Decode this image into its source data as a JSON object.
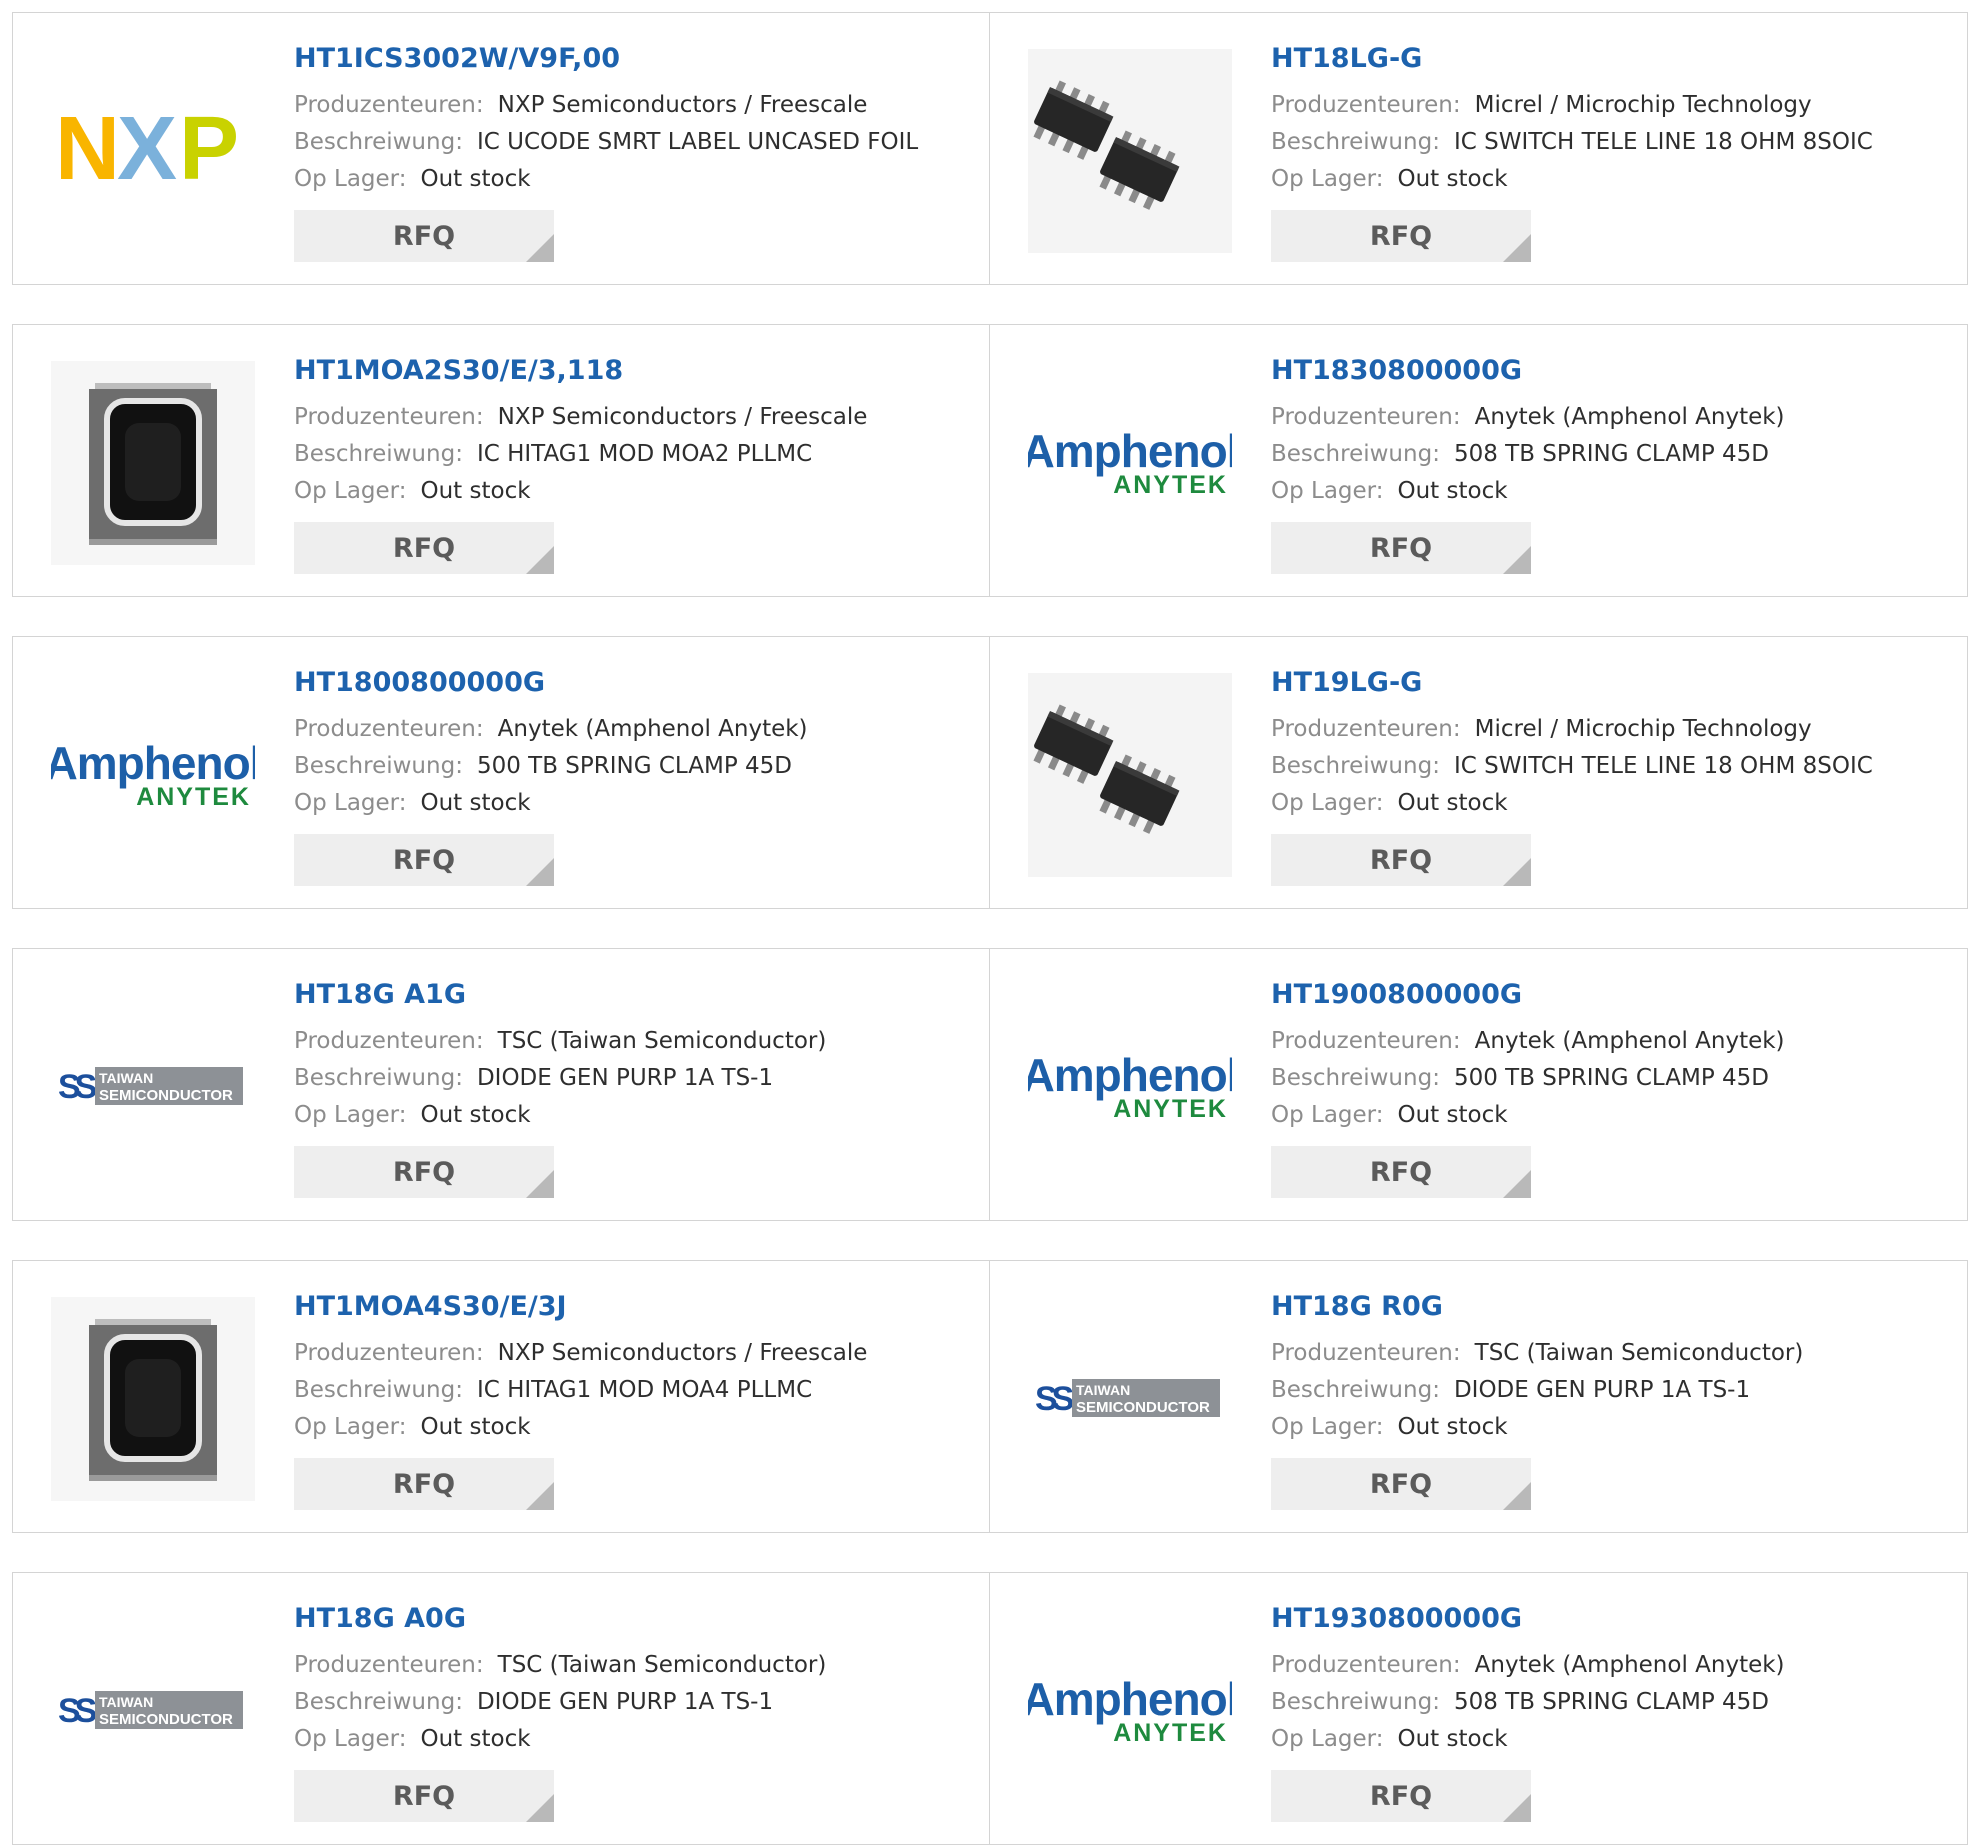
{
  "labels": {
    "manufacturer": "Produzenteuren:",
    "description": "Beschreiwung:",
    "stock": "Op Lager:",
    "rfq": "RFQ"
  },
  "products": [
    {
      "part": "HT1ICS3002W/V9F,00",
      "manufacturer": "NXP Semiconductors / Freescale",
      "description": "IC UCODE SMRT LABEL UNCASED FOIL",
      "stock": "Out stock",
      "image": "nxp-logo"
    },
    {
      "part": "HT18LG-G",
      "manufacturer": "Micrel / Microchip Technology",
      "description": "IC SWITCH TELE LINE 18 OHM 8SOIC",
      "stock": "Out stock",
      "image": "soic-chip"
    },
    {
      "part": "HT1MOA2S30/E/3,118",
      "manufacturer": "NXP Semiconductors / Freescale",
      "description": "IC HITAG1 MOD MOA2 PLLMC",
      "stock": "Out stock",
      "image": "rfid-module"
    },
    {
      "part": "HT1830800000G",
      "manufacturer": "Anytek (Amphenol Anytek)",
      "description": "508 TB SPRING CLAMP 45D",
      "stock": "Out stock",
      "image": "amphenol-logo"
    },
    {
      "part": "HT1800800000G",
      "manufacturer": "Anytek (Amphenol Anytek)",
      "description": "500 TB SPRING CLAMP 45D",
      "stock": "Out stock",
      "image": "amphenol-logo"
    },
    {
      "part": "HT19LG-G",
      "manufacturer": "Micrel / Microchip Technology",
      "description": "IC SWITCH TELE LINE 18 OHM 8SOIC",
      "stock": "Out stock",
      "image": "soic-chip"
    },
    {
      "part": "HT18G A1G",
      "manufacturer": "TSC (Taiwan Semiconductor)",
      "description": "DIODE GEN PURP 1A TS-1",
      "stock": "Out stock",
      "image": "tsc-logo"
    },
    {
      "part": "HT1900800000G",
      "manufacturer": "Anytek (Amphenol Anytek)",
      "description": "500 TB SPRING CLAMP 45D",
      "stock": "Out stock",
      "image": "amphenol-logo"
    },
    {
      "part": "HT1MOA4S30/E/3J",
      "manufacturer": "NXP Semiconductors / Freescale",
      "description": "IC HITAG1 MOD MOA4 PLLMC",
      "stock": "Out stock",
      "image": "rfid-module"
    },
    {
      "part": "HT18G R0G",
      "manufacturer": "TSC (Taiwan Semiconductor)",
      "description": "DIODE GEN PURP 1A TS-1",
      "stock": "Out stock",
      "image": "tsc-logo"
    },
    {
      "part": "HT18G A0G",
      "manufacturer": "TSC (Taiwan Semiconductor)",
      "description": "DIODE GEN PURP 1A TS-1",
      "stock": "Out stock",
      "image": "tsc-logo"
    },
    {
      "part": "HT1930800000G",
      "manufacturer": "Anytek (Amphenol Anytek)",
      "description": "508 TB SPRING CLAMP 45D",
      "stock": "Out stock",
      "image": "amphenol-logo"
    }
  ],
  "logos": {
    "nxp": {
      "letters": [
        "N",
        "X",
        "P"
      ],
      "colors": [
        "#f9b500",
        "#7bb1db",
        "#c9d200"
      ]
    },
    "amphenol": {
      "word": "Amphenol",
      "sub": "ANYTEK",
      "colors": [
        "#1d5fa8",
        "#1e8a3e"
      ]
    },
    "tsc": {
      "line1": "TAIWAN",
      "line2": "SEMICONDUCTOR",
      "colors": [
        "#1c4f9c",
        "#8d9196"
      ]
    }
  },
  "colors": {
    "part_link": "#1d62ad",
    "label": "#8c8c8c",
    "value": "#2e2e2e",
    "border": "#d4d4d4",
    "rfq_bg": "#eeeeee",
    "rfq_text": "#5b5b5b"
  }
}
